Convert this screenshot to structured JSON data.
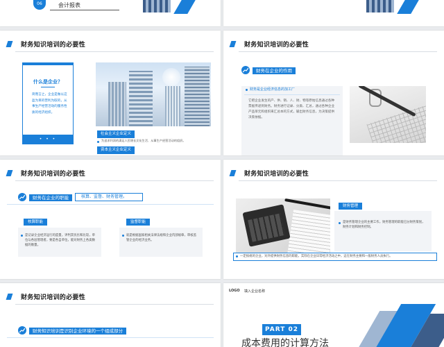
{
  "row0": {
    "left": {
      "number": "06",
      "text": "会计报表"
    }
  },
  "common": {
    "section_title": "财务知识培训的必要性"
  },
  "slide_a": {
    "q_title": "什么是企业？",
    "q_body": "简而言之，企业是做以这盈为目的营利为取的，从事生产经营活动的服务性质的经济组织。",
    "q_dots": "• • •",
    "chip1": "社会主义企业定义",
    "chip1_text": "为追求利润的满足人民增长文化生活、从事生产经营活动的组织。",
    "chip2": "资本主义企业定义",
    "chip2_text": "营利是最终为目的，从事生产经营活动的，随着自身承担的民事责任人利润是按社会主义文明社会所有制的组织。人们是资本主义制度的企业是以资本为目的，而自身的本身是其自身组织的。在实际是在\"经济管理\"企业的各种类型经营组织的。"
  },
  "slide_b": {
    "chip": "财务在企业的作用",
    "sub": "财务是企业经济信息的加工厂",
    "body": "它把企业发生的产、供、销、人、财、物等原始信息通过各种票据传递到财务。财务进行记录、分类、汇总，通过各种企业产品单元和组织来汇总本的方式，输出财务信息，为决策提供决策依据。"
  },
  "slide_c": {
    "chip": "财务在企业的职能",
    "box": "核算、监督、财务管理。",
    "card1_title": "核算职能",
    "card1_text": "是记录企业经济运行的度量，评判其优劣和比较，单位与各层管理者，要是各自单位，能对财务上各类数据的衡量。",
    "card2_title": "监督职能",
    "card2_text": "就是根据国家相关法律法规和企业内部规章，审核监管企业的经济业务。"
  },
  "slide_d": {
    "chip": "财务管理",
    "body": "是财务管理企业的主要工作，财务管理的职能已分财务策划，财务计划和财务控制。",
    "note": "一定按规的企业，对外提供财务信息的职能，实际在企业日常经济活动之中，这在财务主要和一般财务人员执行。"
  },
  "slide_e": {
    "chip": "财务知识培训是识别企业环境的一个组成部分"
  },
  "slide_f": {
    "logo": "LOGO",
    "company": "填入企业名称",
    "part": "PART 02",
    "title": "成本费用的计算方法"
  }
}
